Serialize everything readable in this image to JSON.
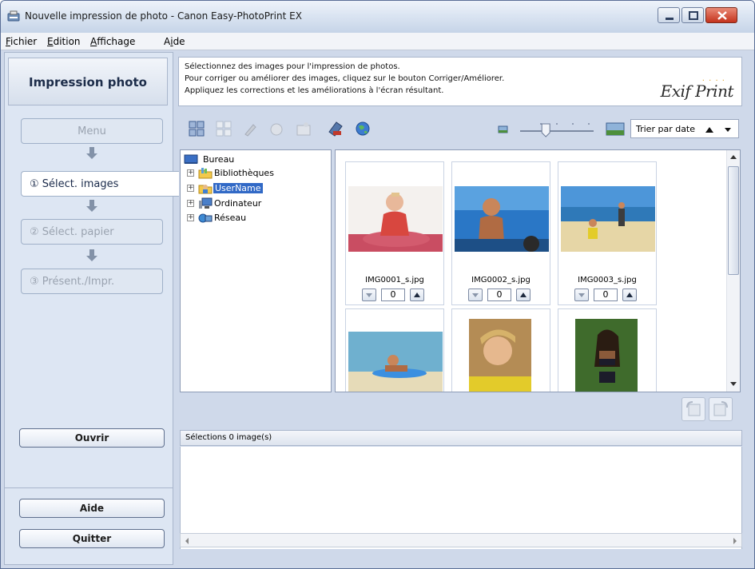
{
  "window": {
    "title": "Nouvelle impression de photo - Canon Easy-PhotoPrint EX"
  },
  "menubar": {
    "items": [
      {
        "label": "Fichier",
        "accel": "F"
      },
      {
        "label": "Edition",
        "accel": "E"
      },
      {
        "label": "Affichage",
        "accel": "A"
      },
      {
        "label": "Aide",
        "accel": "i"
      }
    ]
  },
  "sidebar": {
    "header": "Impression photo",
    "steps": {
      "menu": "Menu",
      "select": "① Sélect. images",
      "paper": "② Sélect. papier",
      "layout": "③ Présent./Impr."
    },
    "buttons": {
      "open": "Ouvrir",
      "help": "Aide",
      "quit": "Quitter"
    }
  },
  "info": {
    "lines": [
      "Sélectionnez des images pour l'impression de photos.",
      "Pour corriger ou améliorer des images, cliquez sur le bouton Corriger/Améliorer.",
      "Appliquez les corrections et les améliorations à l'écran résultant."
    ],
    "logo": "Exif Print"
  },
  "toolbar": {
    "sort_label": "Trier par date",
    "zoom_level": 0.35
  },
  "tree": {
    "root": "Bureau",
    "items": [
      "Bibliothèques",
      "UserName",
      "Ordinateur",
      "Réseau"
    ]
  },
  "thumbnails": [
    {
      "name": "IMG0001_s.jpg",
      "count": "0"
    },
    {
      "name": "IMG0002_s.jpg",
      "count": "0"
    },
    {
      "name": "IMG0003_s.jpg",
      "count": "0"
    },
    {
      "name": "",
      "count": ""
    },
    {
      "name": "",
      "count": ""
    },
    {
      "name": "",
      "count": ""
    }
  ],
  "selection": {
    "header": "Sélections 0 image(s)"
  },
  "colors": {
    "accent": "#3169c6",
    "panel": "#dde6f3",
    "close": "#c4331d"
  }
}
